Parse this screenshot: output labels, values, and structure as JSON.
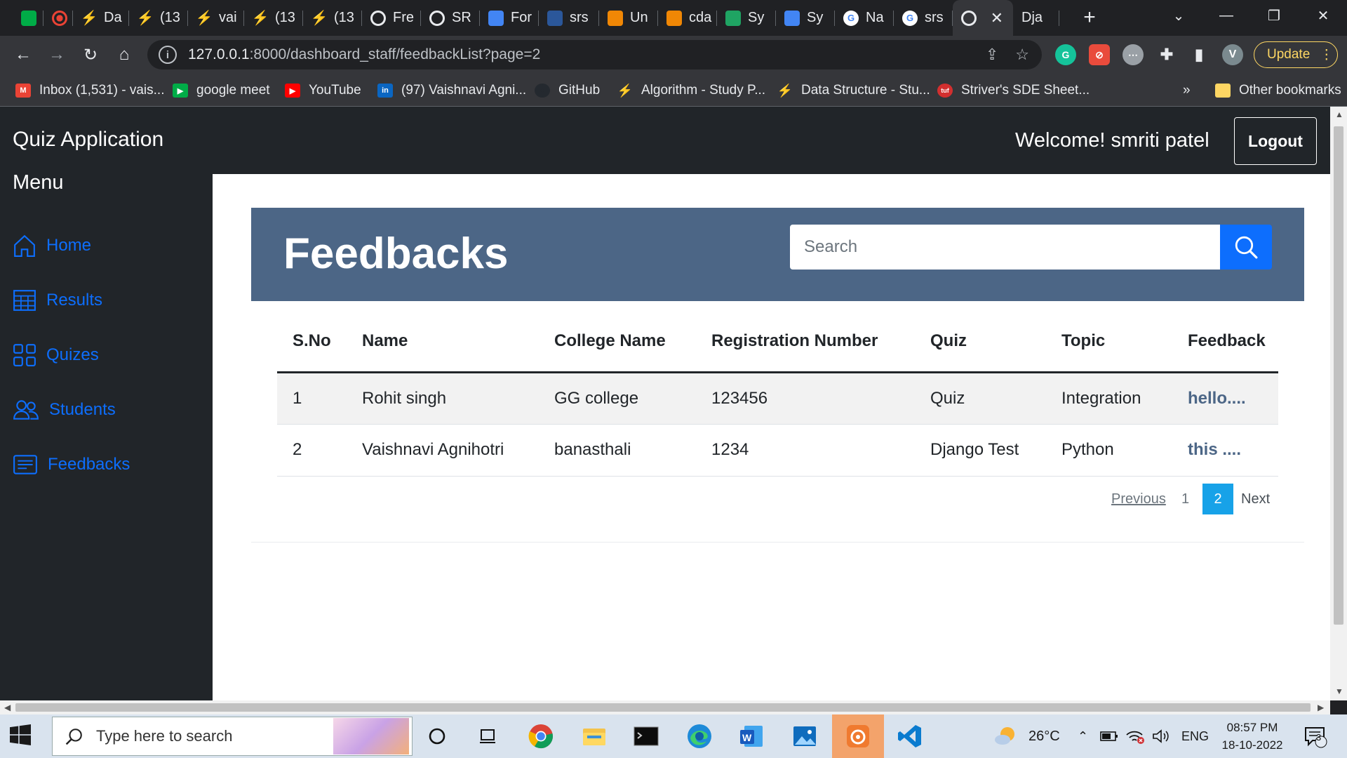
{
  "browser": {
    "tabs": [
      {
        "label": "",
        "icon": "meet-icon",
        "color": "#00ac47"
      },
      {
        "label": "",
        "icon": "record-icon",
        "color": "#ea4335"
      },
      {
        "label": "Da",
        "icon": "codingninja-icon",
        "color": "#f08a24"
      },
      {
        "label": "(13",
        "icon": "codingninja-icon",
        "color": "#f08a24"
      },
      {
        "label": "vai",
        "icon": "codingninja-icon",
        "color": "#f08a24"
      },
      {
        "label": "(13",
        "icon": "codingninja-icon",
        "color": "#f08a24"
      },
      {
        "label": "(13",
        "icon": "codingninja-icon",
        "color": "#f08a24"
      },
      {
        "label": "Fre",
        "icon": "globe-icon",
        "color": "#e8eaed"
      },
      {
        "label": "SR",
        "icon": "globe-icon",
        "color": "#e8eaed"
      },
      {
        "label": "For",
        "icon": "docs-icon",
        "color": "#4285f4"
      },
      {
        "label": "srs",
        "icon": "word-icon",
        "color": "#2b579a"
      },
      {
        "label": "Un",
        "icon": "drawio-icon",
        "color": "#f08705"
      },
      {
        "label": "cda",
        "icon": "drawio-icon",
        "color": "#f08705"
      },
      {
        "label": "Sy",
        "icon": "drive-icon",
        "color": "#1fa463"
      },
      {
        "label": "Sy",
        "icon": "docs-icon",
        "color": "#4285f4"
      },
      {
        "label": "Na",
        "icon": "google-icon",
        "color": "#ffffff"
      },
      {
        "label": "srs",
        "icon": "google-icon",
        "color": "#ffffff"
      },
      {
        "label": "",
        "icon": "globe-icon",
        "color": "#e8eaed",
        "active": true
      },
      {
        "label": "Dja",
        "icon": "",
        "color": ""
      }
    ],
    "url_host": "127.0.0.1",
    "url_path": ":8000/dashboard_staff/feedbackList?page=2",
    "profile_initial": "V",
    "update_label": "Update",
    "bookmarks": [
      {
        "label": "Inbox (1,531) - vais...",
        "icon": "gmail-icon"
      },
      {
        "label": "google meet",
        "icon": "meet-icon"
      },
      {
        "label": "YouTube",
        "icon": "youtube-icon"
      },
      {
        "label": "(97) Vaishnavi Agni...",
        "icon": "linkedin-icon"
      },
      {
        "label": "GitHub",
        "icon": "github-icon"
      },
      {
        "label": "Algorithm - Study P...",
        "icon": "codingninja-icon"
      },
      {
        "label": "Data Structure - Stu...",
        "icon": "codingninja-icon"
      },
      {
        "label": "Striver's SDE Sheet...",
        "icon": "tuf-icon"
      }
    ],
    "more_bookmarks": "»",
    "other_bookmarks": "Other bookmarks"
  },
  "app": {
    "brand": "Quiz Application",
    "welcome": "Welcome! smriti patel",
    "logout": "Logout",
    "menu_title": "Menu",
    "sidebar": [
      {
        "label": "Home",
        "icon": "home-icon"
      },
      {
        "label": "Results",
        "icon": "table-icon"
      },
      {
        "label": "Quizes",
        "icon": "grid-icon"
      },
      {
        "label": "Students",
        "icon": "people-icon"
      },
      {
        "label": "Feedbacks",
        "icon": "card-text-icon"
      }
    ],
    "accent": "#0d6efd"
  },
  "feedbacks": {
    "title": "Feedbacks",
    "search_placeholder": "Search",
    "columns": [
      "S.No",
      "Name",
      "College Name",
      "Registration Number",
      "Quiz",
      "Topic",
      "Feedback"
    ],
    "rows": [
      [
        "1",
        "Rohit singh",
        "GG college",
        "123456",
        "Quiz",
        "Integration",
        "hello...."
      ],
      [
        "2",
        "Vaishnavi Agnihotri",
        "banasthali",
        "1234",
        "Django Test",
        "Python",
        "this ...."
      ]
    ],
    "pagination": {
      "previous": "Previous",
      "pages": [
        "1",
        "2"
      ],
      "current": "2",
      "next": "Next"
    }
  },
  "taskbar": {
    "search_placeholder": "Type here to search",
    "temperature": "26°C",
    "language": "ENG",
    "time": "08:57 PM",
    "date": "18-10-2022",
    "notifications": "3"
  }
}
